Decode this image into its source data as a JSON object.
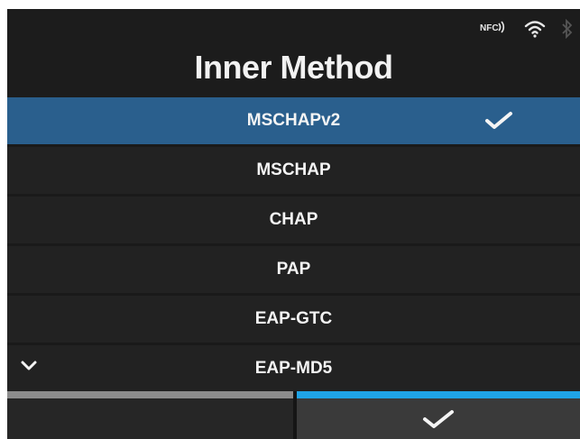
{
  "header": {
    "title": "Inner Method",
    "status": {
      "nfc_label": "NFC",
      "icons": [
        "nfc-icon",
        "wifi-icon",
        "bluetooth-icon"
      ]
    }
  },
  "list": {
    "items": [
      {
        "label": "MSCHAPv2",
        "selected": true
      },
      {
        "label": "MSCHAP",
        "selected": false
      },
      {
        "label": "CHAP",
        "selected": false
      },
      {
        "label": "PAP",
        "selected": false
      },
      {
        "label": "EAP-GTC",
        "selected": false
      },
      {
        "label": "EAP-MD5",
        "selected": false
      }
    ],
    "more_below_icon": "chevron-down-icon"
  },
  "footer": {
    "left_button_icon": "",
    "right_button_icon": "check-icon"
  },
  "colors": {
    "background": "#1a1a1a",
    "item_background": "#222222",
    "selected_background": "#2a5f8d",
    "accent": "#1fa3e6",
    "inactive_bar": "#8c8c8c"
  }
}
